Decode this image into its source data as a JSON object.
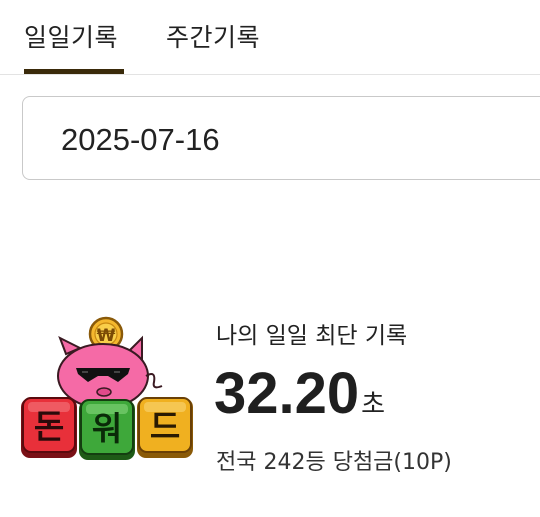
{
  "tabs": [
    {
      "label": "일일기록",
      "active": true
    },
    {
      "label": "주간기록",
      "active": false
    }
  ],
  "date": {
    "value": "2025-07-16"
  },
  "record": {
    "title": "나의 일일 최단 기록",
    "time_value": "32.20",
    "time_unit": "초",
    "rank_line": "전국 242등 당첨금(10P)"
  },
  "logo": {
    "coin_symbol": "₩",
    "tiles": [
      "돈",
      "워",
      "드"
    ],
    "tile_colors": [
      "#e8303a",
      "#3ea83a",
      "#f0b020"
    ]
  },
  "colors": {
    "active_tab_underline": "#3a2a0a",
    "pig_pink": "#f56aa6",
    "coin_gold": "#f5b82e"
  }
}
